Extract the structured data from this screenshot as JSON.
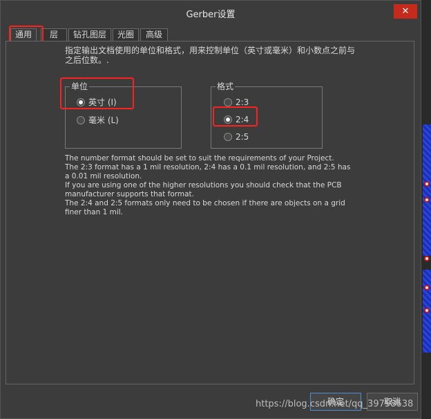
{
  "window": {
    "title": "Gerber设置",
    "close_label": "✕"
  },
  "tabs": [
    {
      "label": "通用",
      "active": true
    },
    {
      "label": "层",
      "active": false
    },
    {
      "label": "钻孔图层",
      "active": false
    },
    {
      "label": "光圈",
      "active": false
    },
    {
      "label": "高级",
      "active": false
    }
  ],
  "description": "指定输出文档使用的单位和格式，用来控制单位（英寸或毫米）和小数点之前与之后位数。.",
  "units": {
    "title": "单位",
    "options": [
      {
        "label": "英寸 (I)",
        "checked": true
      },
      {
        "label": "毫米 (L)",
        "checked": false
      }
    ]
  },
  "format": {
    "title": "格式",
    "options": [
      {
        "label": "2:3",
        "checked": false
      },
      {
        "label": "2:4",
        "checked": true
      },
      {
        "label": "2:5",
        "checked": false
      }
    ]
  },
  "info_lines": [
    "The number format should be set to suit the requirements of your Project.",
    "The 2:3 format has a 1 mil resolution, 2:4 has a 0.1 mil resolution, and 2:5 has a 0.01 mil resolution.",
    "If you are using one of the higher resolutions you should check that the PCB manufacturer supports that format.",
    "The 2:4 and 2:5 formats only need to be chosen if there are objects on a grid finer than 1 mil."
  ],
  "buttons": {
    "ok": "确定",
    "cancel": "取消"
  },
  "watermark": "https://blog.csdn.net/qq_39758638",
  "colors": {
    "highlight": "#ff2020",
    "close": "#c42b1c",
    "pcb_blue": "#2c44d8"
  }
}
